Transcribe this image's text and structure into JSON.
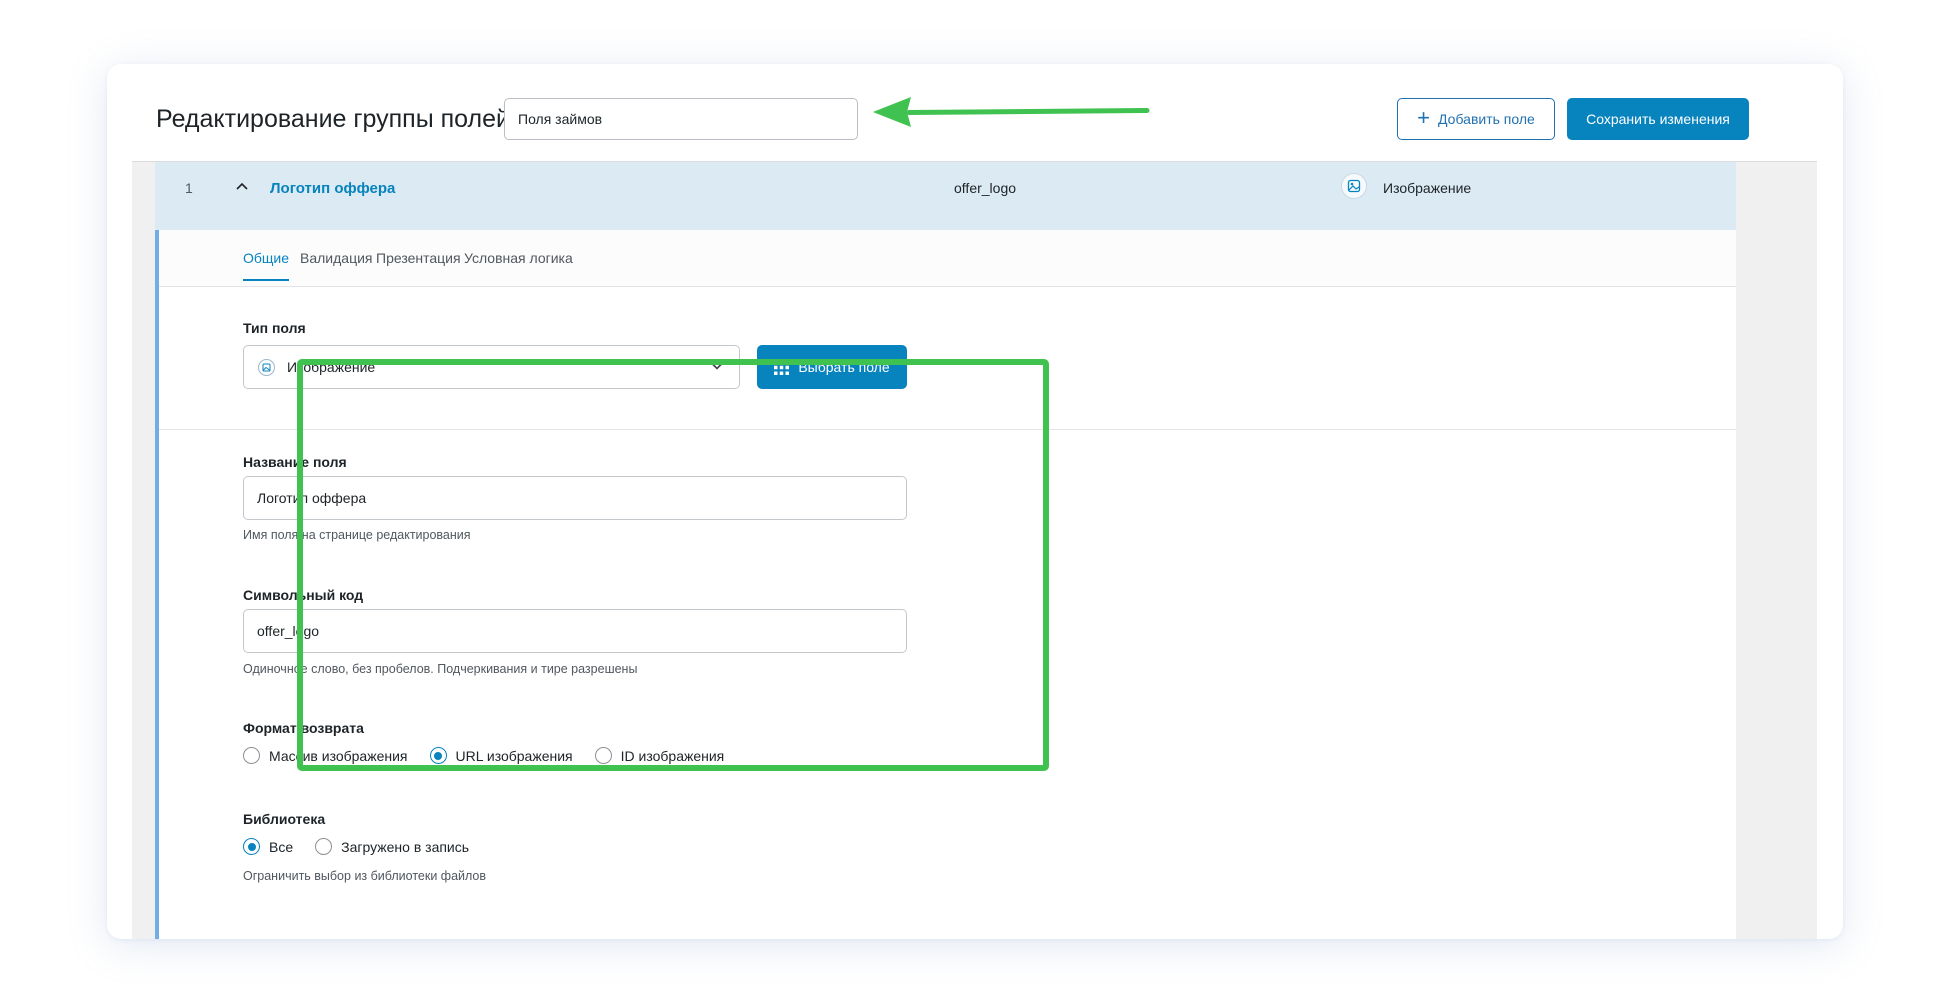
{
  "header": {
    "title": "Редактирование группы полей",
    "group_name": "Поля займов",
    "add_field_label": "Добавить поле",
    "save_label": "Сохранить изменения"
  },
  "field": {
    "number": "1",
    "label": "Логотип оффера",
    "key": "offer_logo",
    "type": "Изображение",
    "type_icon": "image-icon"
  },
  "tabs": [
    {
      "label": "Общие",
      "active": true
    },
    {
      "label": "Валидация",
      "active": false
    },
    {
      "label": "Презентация",
      "active": false
    },
    {
      "label": "Условная логика",
      "active": false
    }
  ],
  "settings": {
    "field_type": {
      "label": "Тип поля",
      "value": "Изображение",
      "choose_button": "Выбрать поле"
    },
    "field_label": {
      "label": "Название поля",
      "value": "Логотип оффера",
      "help": "Имя поля на странице редактирования"
    },
    "field_name": {
      "label": "Символьный код",
      "value": "offer_logo",
      "help": "Одиночное слово, без пробелов. Подчеркивания и тире разрешены"
    },
    "return_format": {
      "label": "Формат возврата",
      "options": [
        "Массив изображения",
        "URL изображения",
        "ID изображения"
      ],
      "selected": "URL изображения"
    },
    "library": {
      "label": "Библиотека",
      "options": [
        "Все",
        "Загружено в запись"
      ],
      "selected": "Все",
      "help": "Ограничить выбор из библиотеки файлов"
    }
  },
  "colors": {
    "accent": "#0783be",
    "highlight": "#3fc24f",
    "row_bg": "#dbeaf3"
  }
}
